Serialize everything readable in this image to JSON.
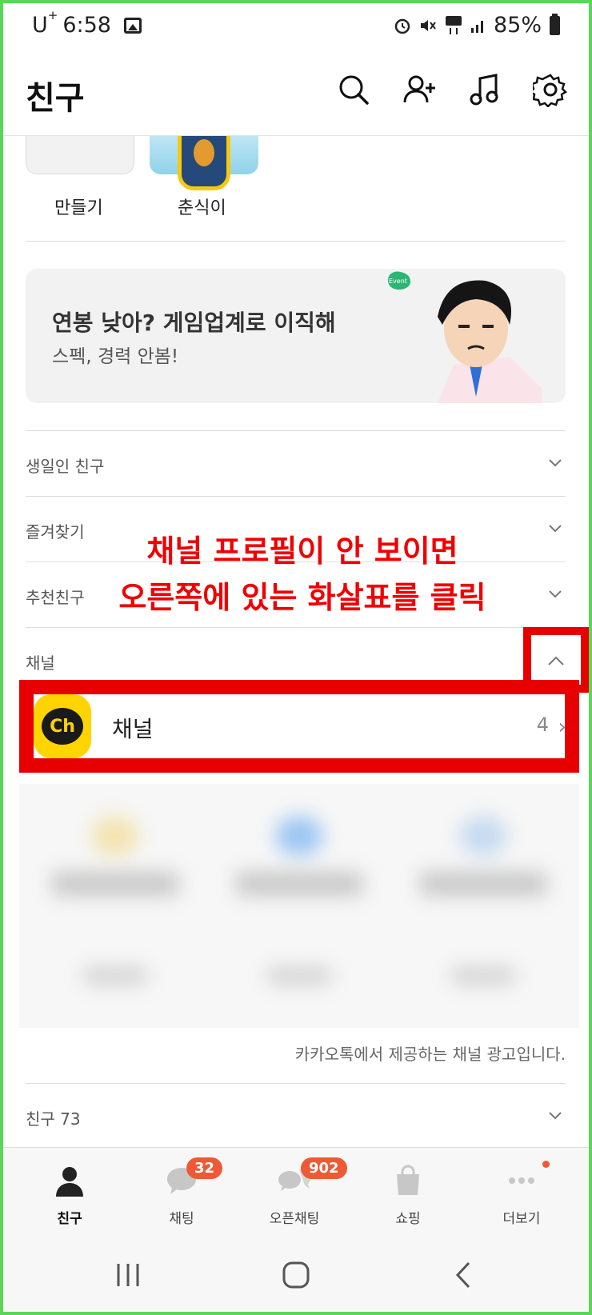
{
  "status_bar": {
    "carrier": "U",
    "carrier_sup": "+",
    "time": "6:58",
    "battery": "85%"
  },
  "header": {
    "title": "친구"
  },
  "profiles": [
    {
      "label": "만들기"
    },
    {
      "label": "춘식이"
    }
  ],
  "banner": {
    "title": "연봉 낮아? 게임업계로 이직해",
    "subtitle": "스펙, 경력 안봄!",
    "tag": "Event"
  },
  "sections": {
    "birthday": "생일인 친구",
    "favorites": "즐겨찾기",
    "recommended": "추천친구",
    "channel": "채널",
    "friends": "친구 73"
  },
  "annotation": {
    "line1": "채널 프로필이 안 보이면",
    "line2": "오른쪽에 있는 화살표를 클릭"
  },
  "channel_item": {
    "logo": "Ch",
    "name": "채널",
    "count": "4"
  },
  "ad_note": "카카오톡에서 제공하는 채널 광고입니다.",
  "tabs": [
    {
      "label": "친구",
      "icon": "person-icon"
    },
    {
      "label": "채팅",
      "icon": "chat-icon",
      "badge": "32"
    },
    {
      "label": "오픈채팅",
      "icon": "open-chat-icon",
      "badge": "902"
    },
    {
      "label": "쇼핑",
      "icon": "shopping-bag-icon"
    },
    {
      "label": "더보기",
      "icon": "more-icon"
    }
  ],
  "colors": {
    "accent": "#ffd400",
    "badge": "#ee5a36",
    "annotation": "#e60000"
  }
}
